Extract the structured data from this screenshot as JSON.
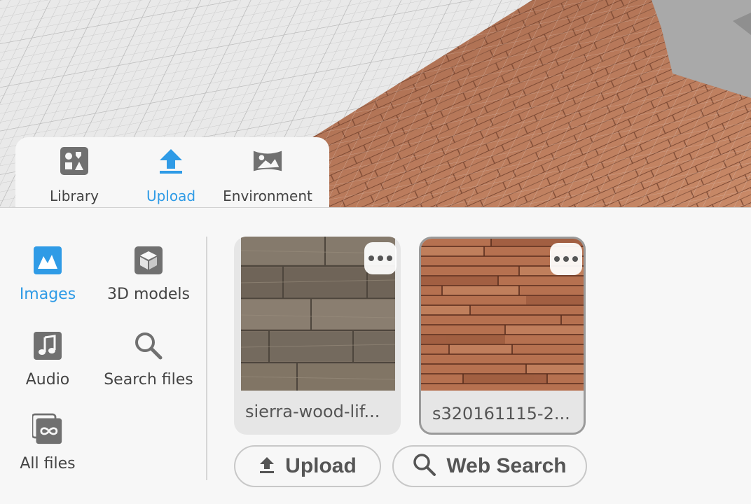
{
  "tabs": [
    {
      "label": "Library",
      "icon": "shapes-icon",
      "active": false
    },
    {
      "label": "Upload",
      "icon": "upload-arrow-icon",
      "active": true
    },
    {
      "label": "Environment",
      "icon": "landscape-icon",
      "active": false
    }
  ],
  "categories": [
    {
      "label": "Images",
      "icon": "image-icon",
      "active": true
    },
    {
      "label": "3D models",
      "icon": "cube-icon",
      "active": false
    },
    {
      "label": "Audio",
      "icon": "music-note-icon",
      "active": false
    },
    {
      "label": "Search files",
      "icon": "search-icon",
      "active": false
    },
    {
      "label": "All files",
      "icon": "infinity-icon",
      "active": false
    }
  ],
  "assets": [
    {
      "name": "sierra-wood-lif...",
      "texture": "grey-wood-planks",
      "selected": false
    },
    {
      "name": "s320161115-2...",
      "texture": "red-wood-planks",
      "selected": true
    }
  ],
  "buttons": {
    "upload_label": "Upload",
    "web_search_label": "Web Search"
  },
  "colors": {
    "accent": "#2f9be6",
    "icon_grey": "#707070",
    "panel_bg": "#f7f7f7"
  }
}
